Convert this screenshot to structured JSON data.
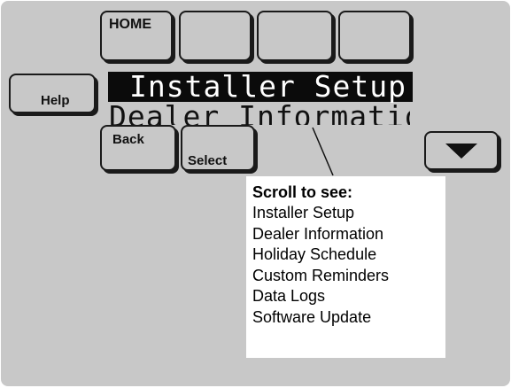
{
  "top_buttons": {
    "home_label": "HOME",
    "blank_1_label": "",
    "blank_2_label": "",
    "blank_3_label": ""
  },
  "side_buttons": {
    "help_label": "Help",
    "back_label": "Back",
    "select_label": "Select",
    "down_icon": "down-triangle-icon"
  },
  "menu": {
    "selected_item": "Installer Setup",
    "next_item": "Dealer Information"
  },
  "callout": {
    "title": "Scroll to see:",
    "items": [
      "Installer Setup",
      "Dealer Information",
      "Holiday Schedule",
      "Custom Reminders",
      "Data Logs",
      "Software Update"
    ]
  },
  "colors": {
    "screen_background": "#c8c8c8",
    "highlight_background": "#0b0b0b",
    "highlight_text": "#ffffff",
    "callout_background": "#ffffff"
  }
}
